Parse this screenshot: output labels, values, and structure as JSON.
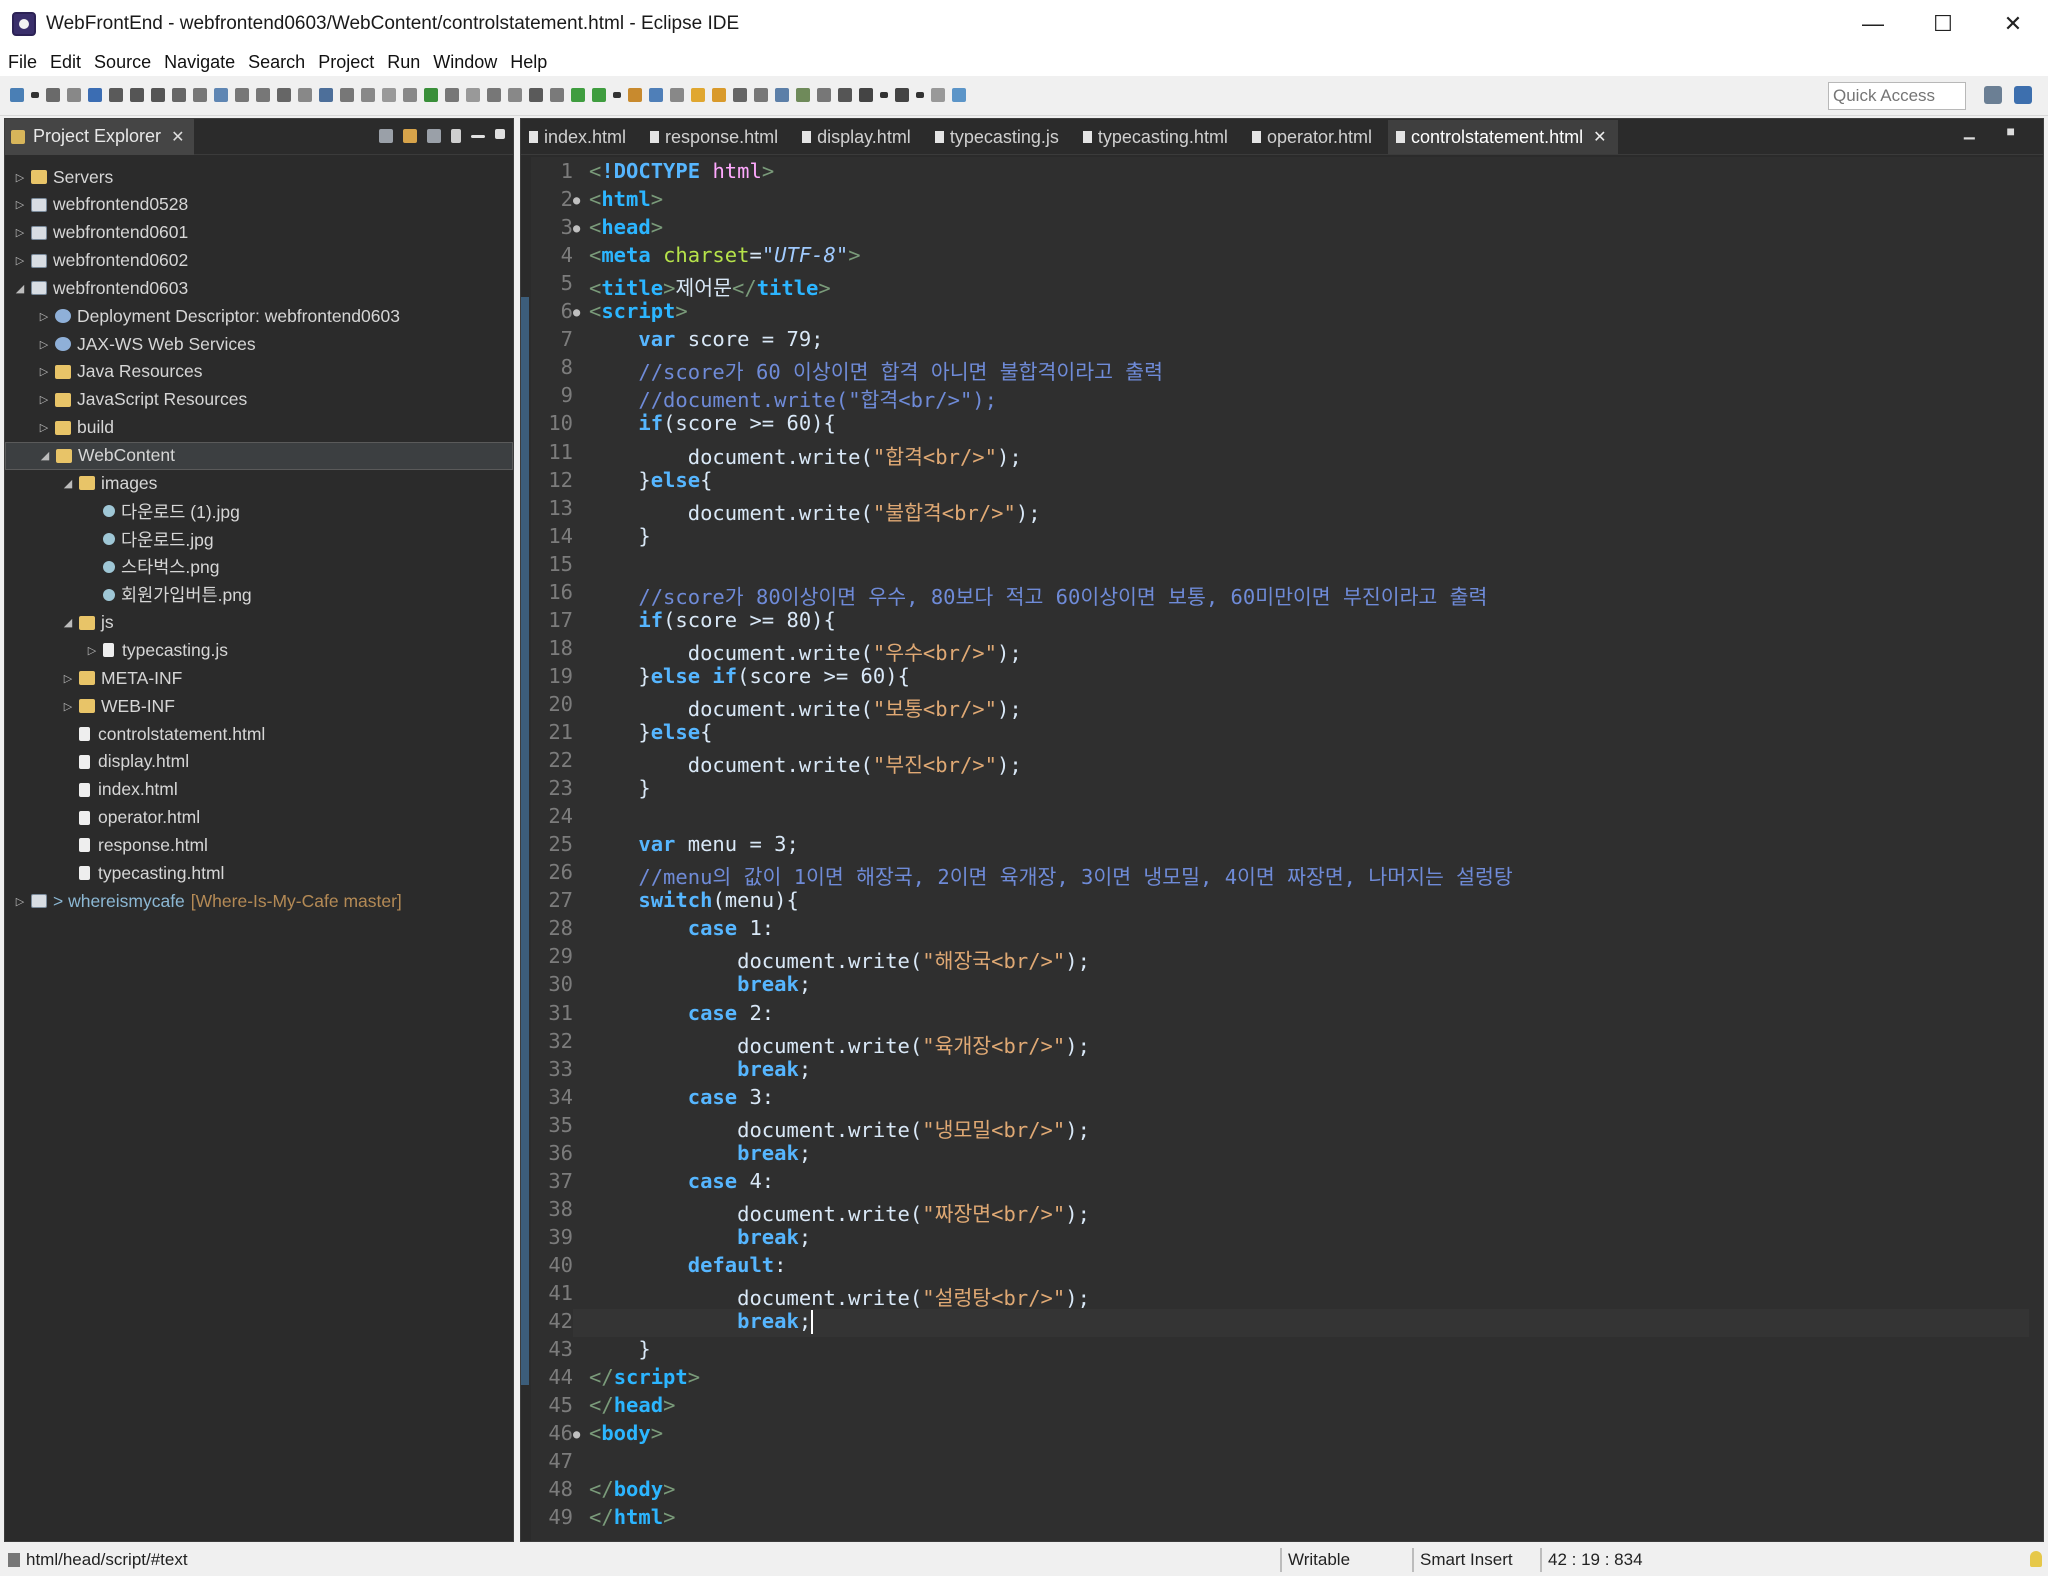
{
  "window": {
    "title": "WebFrontEnd - webfrontend0603/WebContent/controlstatement.html - Eclipse IDE",
    "minimize": "—",
    "maximize": "☐",
    "close": "✕"
  },
  "menu": [
    "File",
    "Edit",
    "Source",
    "Navigate",
    "Search",
    "Project",
    "Run",
    "Window",
    "Help"
  ],
  "quick_access": {
    "placeholder": "Quick Access"
  },
  "explorer": {
    "tab_label": "Project Explorer",
    "tree": [
      {
        "label": "Servers",
        "depth": 0,
        "icon": "folder",
        "arrow": "collapsed"
      },
      {
        "label": "webfrontend0528",
        "depth": 0,
        "icon": "project",
        "arrow": "collapsed"
      },
      {
        "label": "webfrontend0601",
        "depth": 0,
        "icon": "project",
        "arrow": "collapsed"
      },
      {
        "label": "webfrontend0602",
        "depth": 0,
        "icon": "project",
        "arrow": "collapsed"
      },
      {
        "label": "webfrontend0603",
        "depth": 0,
        "icon": "project",
        "arrow": "expanded"
      },
      {
        "label": "Deployment Descriptor: webfrontend0603",
        "depth": 1,
        "icon": "gear",
        "arrow": "collapsed"
      },
      {
        "label": "JAX-WS Web Services",
        "depth": 1,
        "icon": "gear",
        "arrow": "collapsed"
      },
      {
        "label": "Java Resources",
        "depth": 1,
        "icon": "folder",
        "arrow": "collapsed"
      },
      {
        "label": "JavaScript Resources",
        "depth": 1,
        "icon": "folder",
        "arrow": "collapsed"
      },
      {
        "label": "build",
        "depth": 1,
        "icon": "folder",
        "arrow": "collapsed"
      },
      {
        "label": "WebContent",
        "depth": 1,
        "icon": "folder",
        "arrow": "expanded",
        "selected": true
      },
      {
        "label": "images",
        "depth": 2,
        "icon": "folder",
        "arrow": "expanded"
      },
      {
        "label": "다운로드 (1).jpg",
        "depth": 3,
        "icon": "image",
        "arrow": ""
      },
      {
        "label": "다운로드.jpg",
        "depth": 3,
        "icon": "image",
        "arrow": ""
      },
      {
        "label": "스타벅스.png",
        "depth": 3,
        "icon": "image",
        "arrow": ""
      },
      {
        "label": "회원가입버튼.png",
        "depth": 3,
        "icon": "image",
        "arrow": ""
      },
      {
        "label": "js",
        "depth": 2,
        "icon": "folder",
        "arrow": "expanded"
      },
      {
        "label": "typecasting.js",
        "depth": 3,
        "icon": "file",
        "arrow": "collapsed"
      },
      {
        "label": "META-INF",
        "depth": 2,
        "icon": "folder",
        "arrow": "collapsed"
      },
      {
        "label": "WEB-INF",
        "depth": 2,
        "icon": "folder",
        "arrow": "collapsed"
      },
      {
        "label": "controlstatement.html",
        "depth": 2,
        "icon": "file",
        "arrow": ""
      },
      {
        "label": "display.html",
        "depth": 2,
        "icon": "file",
        "arrow": ""
      },
      {
        "label": "index.html",
        "depth": 2,
        "icon": "file",
        "arrow": ""
      },
      {
        "label": "operator.html",
        "depth": 2,
        "icon": "file",
        "arrow": ""
      },
      {
        "label": "response.html",
        "depth": 2,
        "icon": "file",
        "arrow": ""
      },
      {
        "label": "typecasting.html",
        "depth": 2,
        "icon": "file",
        "arrow": ""
      },
      {
        "label": "> whereismycafe",
        "branch": "[Where-Is-My-Cafe master]",
        "depth": 0,
        "icon": "project",
        "arrow": "collapsed",
        "git": true
      }
    ]
  },
  "editor": {
    "tabs": [
      {
        "label": "index.html",
        "active": false
      },
      {
        "label": "response.html",
        "active": false
      },
      {
        "label": "display.html",
        "active": false
      },
      {
        "label": "typecasting.js",
        "active": false
      },
      {
        "label": "typecasting.html",
        "active": false
      },
      {
        "label": "operator.html",
        "active": false
      },
      {
        "label": "controlstatement.html",
        "active": true
      }
    ],
    "current_line": 42,
    "lines": [
      [
        [
          "br",
          "<"
        ],
        [
          "kw2",
          "!DOCTYPE"
        ],
        [
          "plain",
          " "
        ],
        [
          "kw",
          "html"
        ],
        [
          "br",
          ">"
        ]
      ],
      [
        [
          "br",
          "<"
        ],
        [
          "tag",
          "html"
        ],
        [
          "br",
          ">"
        ]
      ],
      [
        [
          "br",
          "<"
        ],
        [
          "tag",
          "head"
        ],
        [
          "br",
          ">"
        ]
      ],
      [
        [
          "br",
          "<"
        ],
        [
          "tag",
          "meta"
        ],
        [
          "plain",
          " "
        ],
        [
          "attr",
          "charset"
        ],
        [
          "plain",
          "="
        ],
        [
          "aval",
          "\"UTF-8\""
        ],
        [
          "br",
          ">"
        ]
      ],
      [
        [
          "br",
          "<"
        ],
        [
          "tag",
          "title"
        ],
        [
          "br",
          ">"
        ],
        [
          "tagtxt",
          "제어문"
        ],
        [
          "br",
          "</"
        ],
        [
          "tag",
          "title"
        ],
        [
          "br",
          ">"
        ]
      ],
      [
        [
          "br",
          "<"
        ],
        [
          "tag",
          "script"
        ],
        [
          "br",
          ">"
        ]
      ],
      [
        [
          "plain",
          "    "
        ],
        [
          "kw2",
          "var"
        ],
        [
          "plain",
          " score = 79;"
        ]
      ],
      [
        [
          "plain",
          "    "
        ],
        [
          "cm",
          "//score가 60 이상이면 합격 아니면 불합격이라고 출력"
        ]
      ],
      [
        [
          "plain",
          "    "
        ],
        [
          "cm",
          "//document.write(\"합격<br/>\");"
        ]
      ],
      [
        [
          "plain",
          "    "
        ],
        [
          "kw2",
          "if"
        ],
        [
          "plain",
          "(score >= 60){"
        ]
      ],
      [
        [
          "plain",
          "        document.write("
        ],
        [
          "str",
          "\"합격<br/>\""
        ],
        [
          "plain",
          ");"
        ]
      ],
      [
        [
          "plain",
          "    }"
        ],
        [
          "kw2",
          "else"
        ],
        [
          "plain",
          "{"
        ]
      ],
      [
        [
          "plain",
          "        document.write("
        ],
        [
          "str",
          "\"불합격<br/>\""
        ],
        [
          "plain",
          ");"
        ]
      ],
      [
        [
          "plain",
          "    }"
        ]
      ],
      [
        [
          "plain",
          ""
        ]
      ],
      [
        [
          "plain",
          "    "
        ],
        [
          "cm",
          "//score가 80이상이면 우수, 80보다 적고 60이상이면 보통, 60미만이면 부진이라고 출력"
        ]
      ],
      [
        [
          "plain",
          "    "
        ],
        [
          "kw2",
          "if"
        ],
        [
          "plain",
          "(score >= 80){"
        ]
      ],
      [
        [
          "plain",
          "        document.write("
        ],
        [
          "str",
          "\"우수<br/>\""
        ],
        [
          "plain",
          ");"
        ]
      ],
      [
        [
          "plain",
          "    }"
        ],
        [
          "kw2",
          "else if"
        ],
        [
          "plain",
          "(score >= 60){"
        ]
      ],
      [
        [
          "plain",
          "        document.write("
        ],
        [
          "str",
          "\"보통<br/>\""
        ],
        [
          "plain",
          ");"
        ]
      ],
      [
        [
          "plain",
          "    }"
        ],
        [
          "kw2",
          "else"
        ],
        [
          "plain",
          "{"
        ]
      ],
      [
        [
          "plain",
          "        document.write("
        ],
        [
          "str",
          "\"부진<br/>\""
        ],
        [
          "plain",
          ");"
        ]
      ],
      [
        [
          "plain",
          "    }"
        ]
      ],
      [
        [
          "plain",
          ""
        ]
      ],
      [
        [
          "plain",
          "    "
        ],
        [
          "kw2",
          "var"
        ],
        [
          "plain",
          " menu = 3;"
        ]
      ],
      [
        [
          "plain",
          "    "
        ],
        [
          "cm",
          "//menu의 값이 1이면 해장국, 2이면 육개장, 3이면 냉모밀, 4이면 짜장면, 나머지는 설렁탕"
        ]
      ],
      [
        [
          "plain",
          "    "
        ],
        [
          "kw2",
          "switch"
        ],
        [
          "plain",
          "(menu){"
        ]
      ],
      [
        [
          "plain",
          "        "
        ],
        [
          "kw2",
          "case"
        ],
        [
          "plain",
          " 1:"
        ]
      ],
      [
        [
          "plain",
          "            document.write("
        ],
        [
          "str",
          "\"해장국<br/>\""
        ],
        [
          "plain",
          ");"
        ]
      ],
      [
        [
          "plain",
          "            "
        ],
        [
          "kw2",
          "break"
        ],
        [
          "plain",
          ";"
        ]
      ],
      [
        [
          "plain",
          "        "
        ],
        [
          "kw2",
          "case"
        ],
        [
          "plain",
          " 2:"
        ]
      ],
      [
        [
          "plain",
          "            document.write("
        ],
        [
          "str",
          "\"육개장<br/>\""
        ],
        [
          "plain",
          ");"
        ]
      ],
      [
        [
          "plain",
          "            "
        ],
        [
          "kw2",
          "break"
        ],
        [
          "plain",
          ";"
        ]
      ],
      [
        [
          "plain",
          "        "
        ],
        [
          "kw2",
          "case"
        ],
        [
          "plain",
          " 3:"
        ]
      ],
      [
        [
          "plain",
          "            document.write("
        ],
        [
          "str",
          "\"냉모밀<br/>\""
        ],
        [
          "plain",
          ");"
        ]
      ],
      [
        [
          "plain",
          "            "
        ],
        [
          "kw2",
          "break"
        ],
        [
          "plain",
          ";"
        ]
      ],
      [
        [
          "plain",
          "        "
        ],
        [
          "kw2",
          "case"
        ],
        [
          "plain",
          " 4:"
        ]
      ],
      [
        [
          "plain",
          "            document.write("
        ],
        [
          "str",
          "\"짜장면<br/>\""
        ],
        [
          "plain",
          ");"
        ]
      ],
      [
        [
          "plain",
          "            "
        ],
        [
          "kw2",
          "break"
        ],
        [
          "plain",
          ";"
        ]
      ],
      [
        [
          "plain",
          "        "
        ],
        [
          "kw2",
          "default"
        ],
        [
          "plain",
          ":"
        ]
      ],
      [
        [
          "plain",
          "            document.write("
        ],
        [
          "str",
          "\"설렁탕<br/>\""
        ],
        [
          "plain",
          ");"
        ]
      ],
      [
        [
          "plain",
          "            "
        ],
        [
          "kw2",
          "break"
        ],
        [
          "plain",
          ";"
        ]
      ],
      [
        [
          "plain",
          "    }"
        ]
      ],
      [
        [
          "br",
          "</"
        ],
        [
          "tag",
          "script"
        ],
        [
          "br",
          ">"
        ]
      ],
      [
        [
          "br",
          "</"
        ],
        [
          "tag",
          "head"
        ],
        [
          "br",
          ">"
        ]
      ],
      [
        [
          "br",
          "<"
        ],
        [
          "tag",
          "body"
        ],
        [
          "br",
          ">"
        ]
      ],
      [
        [
          "plain",
          ""
        ]
      ],
      [
        [
          "br",
          "</"
        ],
        [
          "tag",
          "body"
        ],
        [
          "br",
          ">"
        ]
      ],
      [
        [
          "br",
          "</"
        ],
        [
          "tag",
          "html"
        ],
        [
          "br",
          ">"
        ]
      ]
    ],
    "fold_lines": [
      2,
      3,
      6,
      46
    ]
  },
  "status": {
    "path": "html/head/script/#text",
    "writable": "Writable",
    "insert_mode": "Smart Insert",
    "position": "42 : 19 : 834"
  }
}
